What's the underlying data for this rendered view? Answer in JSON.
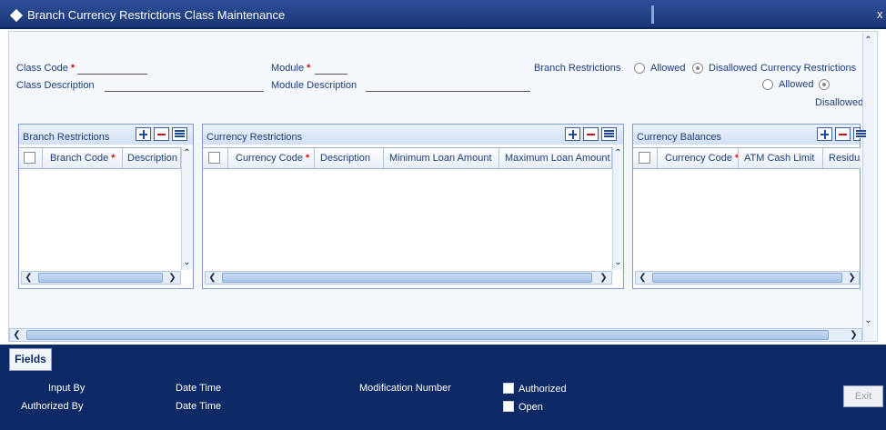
{
  "window": {
    "title": "Branch Currency Restrictions Class Maintenance",
    "close_glyph": "x"
  },
  "form": {
    "class_code_label": "Class Code",
    "class_code_value": "",
    "class_description_label": "Class Description",
    "class_description_value": "",
    "module_label": "Module",
    "module_value": "",
    "module_description_label": "Module Description",
    "module_description_value": "",
    "required_mark": "*",
    "branch_restrictions_label": "Branch Restrictions",
    "branch_restrictions_options": [
      "Allowed",
      "Disallowed"
    ],
    "branch_restrictions_selected": "Disallowed",
    "currency_restrictions_label": "Currency Restrictions",
    "currency_restrictions_options": [
      "Allowed",
      "Disallowed"
    ],
    "currency_restrictions_selected": "Disallowed"
  },
  "grids": {
    "branch": {
      "title": "Branch Restrictions",
      "columns": [
        "Branch Code",
        "Description"
      ],
      "required": [
        true,
        false
      ],
      "rows": []
    },
    "currency": {
      "title": "Currency Restrictions",
      "columns": [
        "Currency Code",
        "Description",
        "Minimum Loan Amount",
        "Maximum Loan Amount"
      ],
      "required": [
        true,
        false,
        false,
        false
      ],
      "rows": []
    },
    "balances": {
      "title": "Currency Balances",
      "columns": [
        "Currency Code",
        "ATM Cash Limit",
        "Residual"
      ],
      "required": [
        true,
        false,
        false
      ],
      "rows": []
    }
  },
  "footer": {
    "fields_button": "Fields",
    "input_by_label": "Input By",
    "authorized_by_label": "Authorized By",
    "date_time_label_1": "Date Time",
    "date_time_label_2": "Date Time",
    "modification_number_label": "Modification Number",
    "authorized_label": "Authorized",
    "authorized_checked": false,
    "open_label": "Open",
    "open_checked": false,
    "exit_button": "Exit"
  },
  "colors": {
    "title_bar": "#1a3675",
    "footer": "#0e2a66",
    "required": "#d01010",
    "label": "#1c3e7a"
  }
}
